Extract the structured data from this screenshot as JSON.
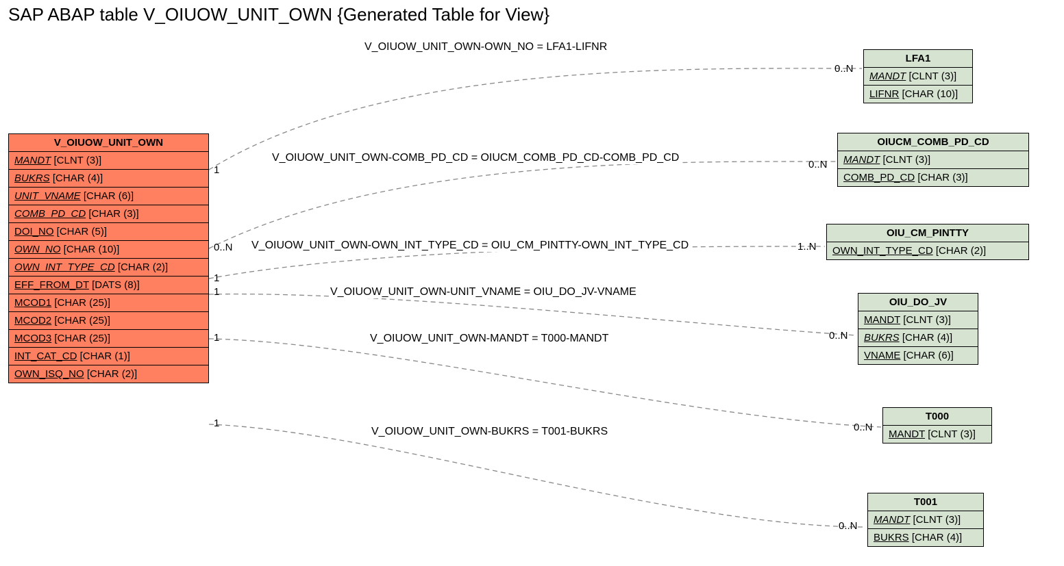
{
  "title": "SAP ABAP table V_OIUOW_UNIT_OWN {Generated Table for View}",
  "main": {
    "name": "V_OIUOW_UNIT_OWN",
    "fields": [
      {
        "name": "MANDT",
        "type": "[CLNT (3)]",
        "italic": true
      },
      {
        "name": "BUKRS",
        "type": "[CHAR (4)]",
        "italic": true
      },
      {
        "name": "UNIT_VNAME",
        "type": "[CHAR (6)]",
        "italic": true
      },
      {
        "name": "COMB_PD_CD",
        "type": "[CHAR (3)]",
        "italic": true
      },
      {
        "name": "DOI_NO",
        "type": "[CHAR (5)]",
        "italic": false
      },
      {
        "name": "OWN_NO",
        "type": "[CHAR (10)]",
        "italic": true
      },
      {
        "name": "OWN_INT_TYPE_CD",
        "type": "[CHAR (2)]",
        "italic": true
      },
      {
        "name": "EFF_FROM_DT",
        "type": "[DATS (8)]",
        "italic": false
      },
      {
        "name": "MCOD1",
        "type": "[CHAR (25)]",
        "italic": false
      },
      {
        "name": "MCOD2",
        "type": "[CHAR (25)]",
        "italic": false
      },
      {
        "name": "MCOD3",
        "type": "[CHAR (25)]",
        "italic": false
      },
      {
        "name": "INT_CAT_CD",
        "type": "[CHAR (1)]",
        "italic": false
      },
      {
        "name": "OWN_ISQ_NO",
        "type": "[CHAR (2)]",
        "italic": false
      }
    ]
  },
  "related": {
    "lfa1": {
      "name": "LFA1",
      "fields": [
        {
          "name": "MANDT",
          "type": "[CLNT (3)]",
          "italic": true
        },
        {
          "name": "LIFNR",
          "type": "[CHAR (10)]",
          "italic": false
        }
      ]
    },
    "oiucm": {
      "name": "OIUCM_COMB_PD_CD",
      "fields": [
        {
          "name": "MANDT",
          "type": "[CLNT (3)]",
          "italic": true
        },
        {
          "name": "COMB_PD_CD",
          "type": "[CHAR (3)]",
          "italic": false
        }
      ]
    },
    "pintty": {
      "name": "OIU_CM_PINTTY",
      "fields": [
        {
          "name": "OWN_INT_TYPE_CD",
          "type": "[CHAR (2)]",
          "italic": false
        }
      ]
    },
    "dojv": {
      "name": "OIU_DO_JV",
      "fields": [
        {
          "name": "MANDT",
          "type": "[CLNT (3)]",
          "italic": false
        },
        {
          "name": "BUKRS",
          "type": "[CHAR (4)]",
          "italic": true
        },
        {
          "name": "VNAME",
          "type": "[CHAR (6)]",
          "italic": false
        }
      ]
    },
    "t000": {
      "name": "T000",
      "fields": [
        {
          "name": "MANDT",
          "type": "[CLNT (3)]",
          "italic": false
        }
      ]
    },
    "t001": {
      "name": "T001",
      "fields": [
        {
          "name": "MANDT",
          "type": "[CLNT (3)]",
          "italic": true
        },
        {
          "name": "BUKRS",
          "type": "[CHAR (4)]",
          "italic": false
        }
      ]
    }
  },
  "relations": {
    "r1": {
      "label": "V_OIUOW_UNIT_OWN-OWN_NO = LFA1-LIFNR",
      "left_card": "1",
      "right_card": "0..N"
    },
    "r2": {
      "label": "V_OIUOW_UNIT_OWN-COMB_PD_CD = OIUCM_COMB_PD_CD-COMB_PD_CD",
      "left_card": "1",
      "right_card": "0..N"
    },
    "r3": {
      "label": "V_OIUOW_UNIT_OWN-OWN_INT_TYPE_CD = OIU_CM_PINTTY-OWN_INT_TYPE_CD",
      "left_card": "0..N",
      "right_card": "1..N"
    },
    "r4": {
      "label": "V_OIUOW_UNIT_OWN-UNIT_VNAME = OIU_DO_JV-VNAME",
      "left_card": "1",
      "right_card": ""
    },
    "r5": {
      "label": "V_OIUOW_UNIT_OWN-MANDT = T000-MANDT",
      "left_card": "1",
      "right_card": "0..N"
    },
    "r6": {
      "label": "V_OIUOW_UNIT_OWN-BUKRS = T001-BUKRS",
      "left_card": "1",
      "right_card": "0..N"
    }
  },
  "extra_cards": {
    "c_below_r4": "1",
    "c_right_dojv_0n": "0..N"
  }
}
